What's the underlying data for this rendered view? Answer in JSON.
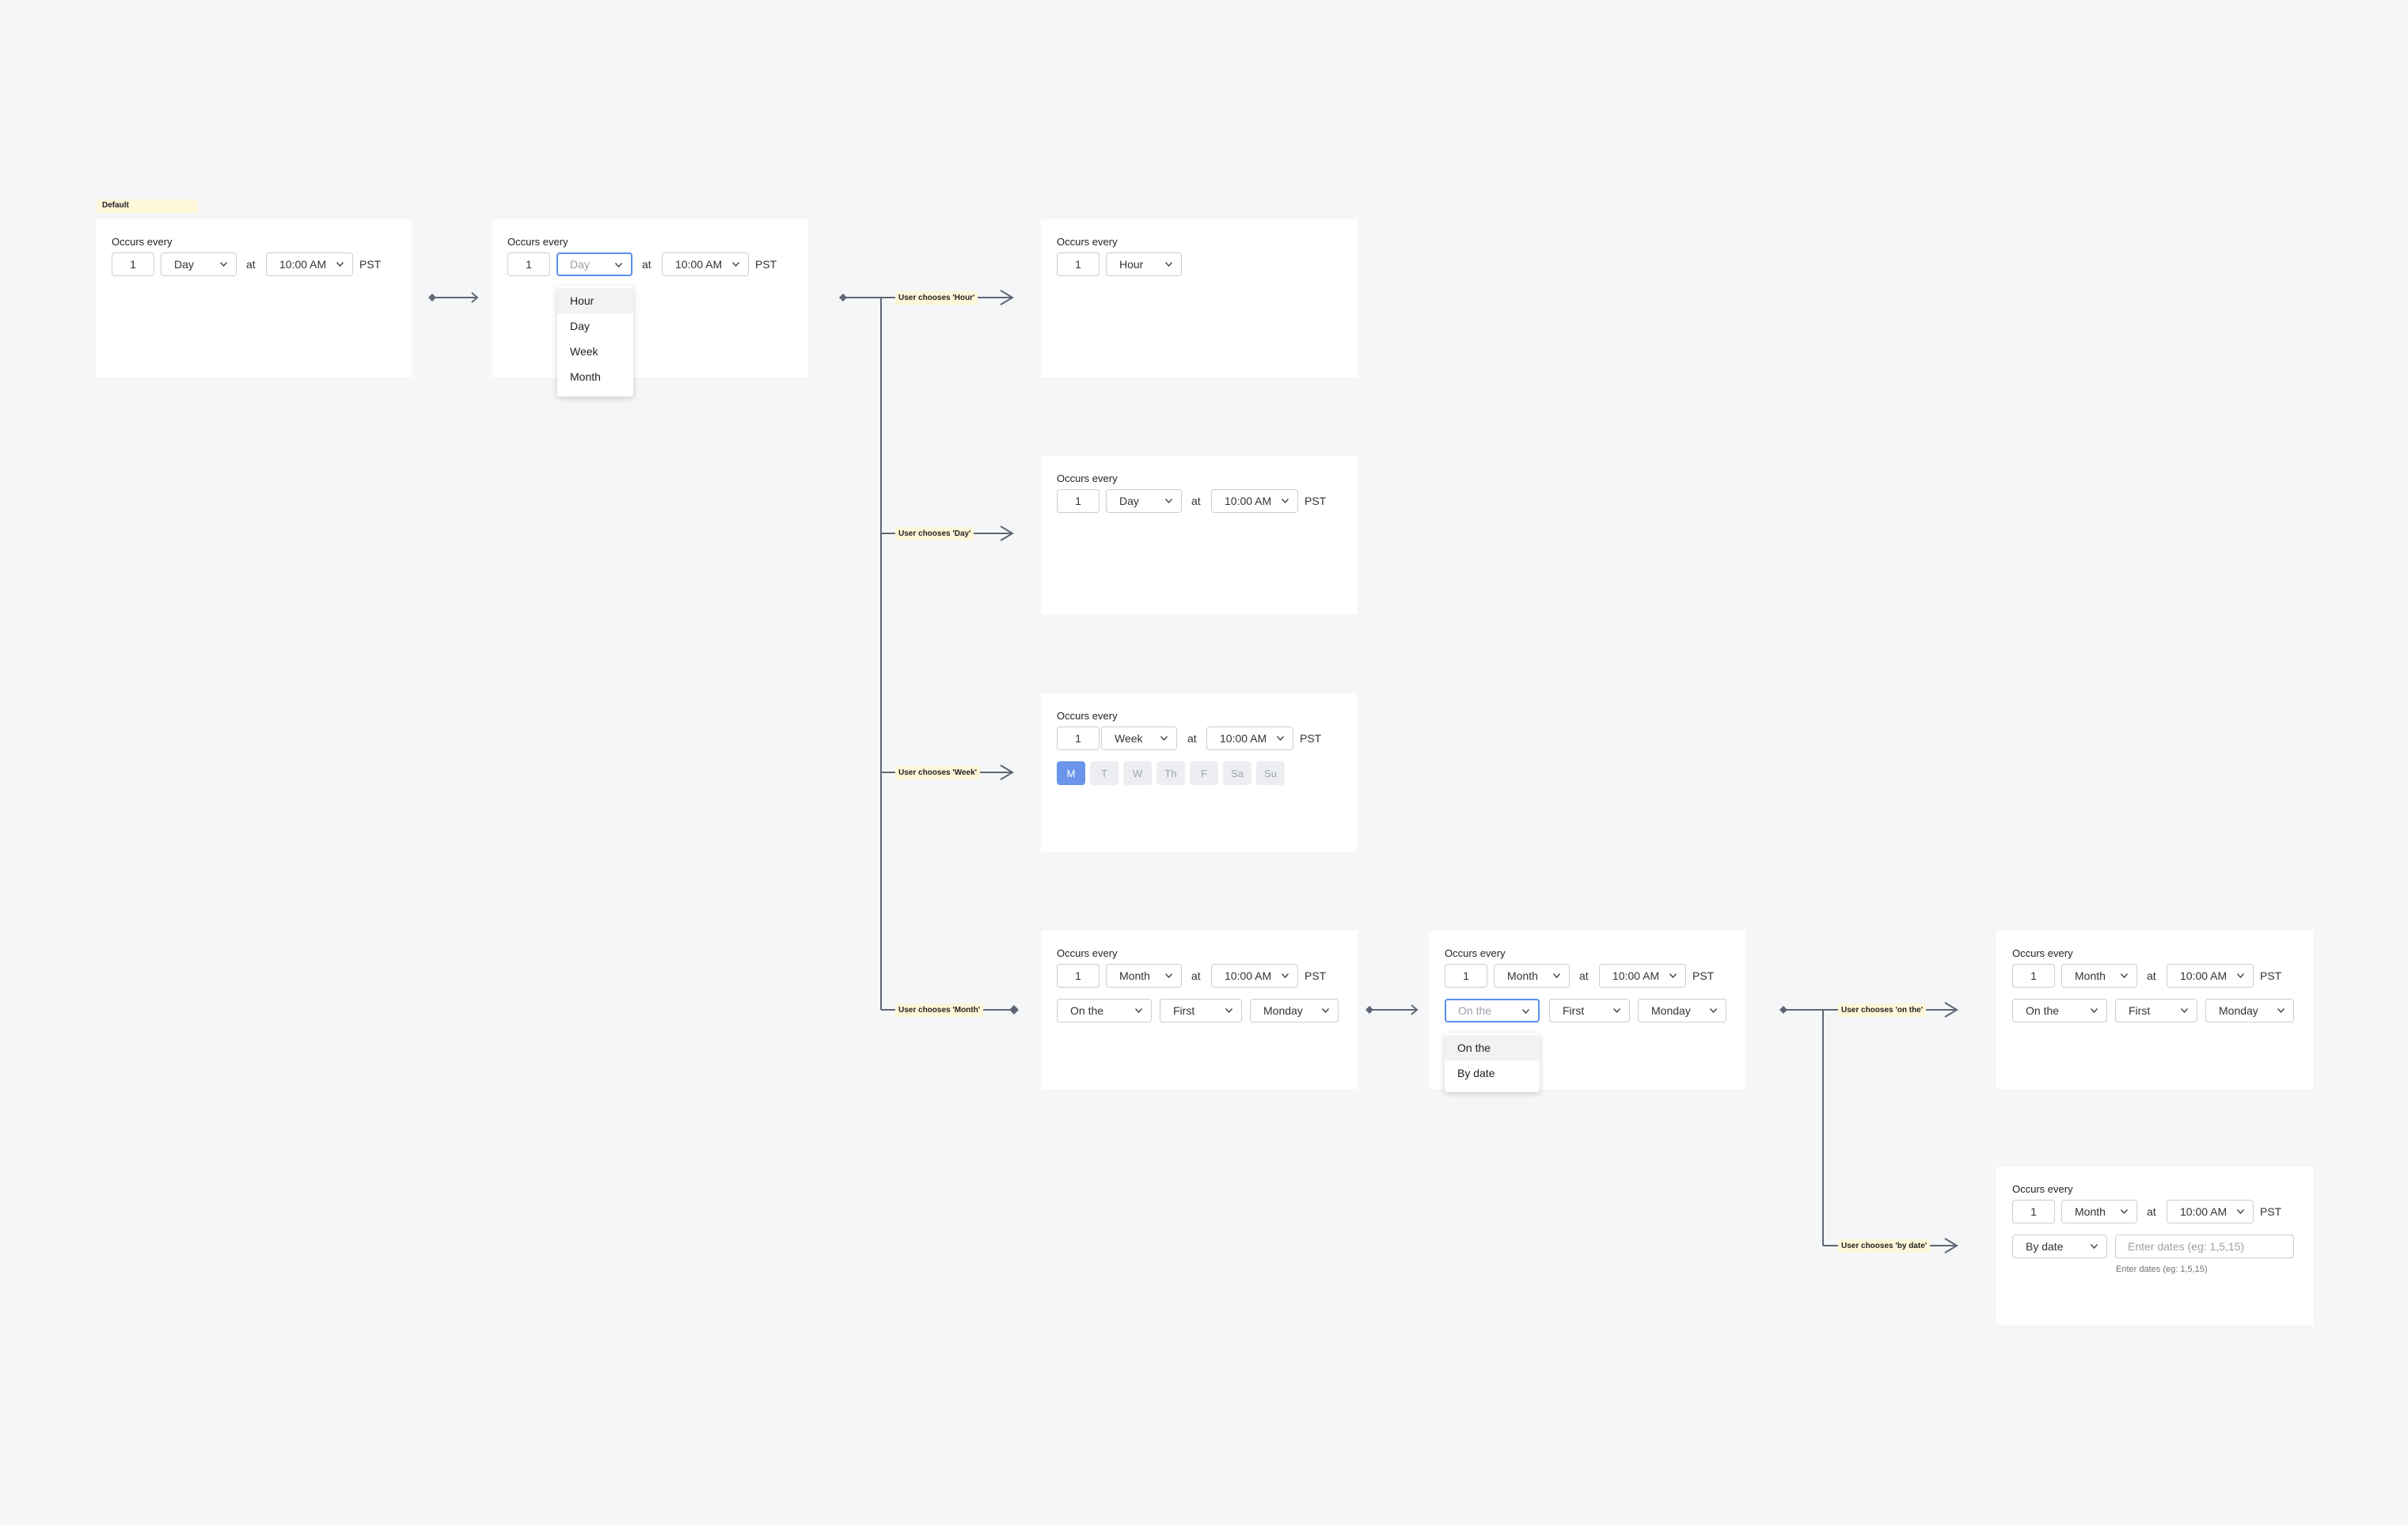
{
  "labels": {
    "occurs_every": "Occurs every",
    "at": "at",
    "tz": "PST",
    "default_tag": "Default"
  },
  "values": {
    "count": "1",
    "time": "10:00 AM",
    "day": "Day",
    "hour": "Hour",
    "week": "Week",
    "month": "Month",
    "on_the": "On the",
    "first": "First",
    "monday": "Monday",
    "by_date": "By date"
  },
  "unit_menu": [
    "Hour",
    "Day",
    "Week",
    "Month"
  ],
  "mode_menu": [
    "On the",
    "By date"
  ],
  "weekdays": [
    "M",
    "T",
    "W",
    "Th",
    "F",
    "Sa",
    "Su"
  ],
  "by_date_input": {
    "placeholder": "Enter dates (eg: 1,5,15)",
    "helper": "Enter dates (eg: 1,5,15)"
  },
  "notes": {
    "hour": "User chooses 'Hour'",
    "day": "User chooses 'Day'",
    "week": "User chooses 'Week'",
    "month": "User chooses 'Month'",
    "on_the": "User chooses 'on the'",
    "by_date": "User chooses 'by date'"
  },
  "colors": {
    "canvas": "#f5f6f8",
    "accent": "#5b8def",
    "selected_day": "#6b95ea",
    "note_bg": "#fdf6d8",
    "connector": "#5f6675"
  }
}
